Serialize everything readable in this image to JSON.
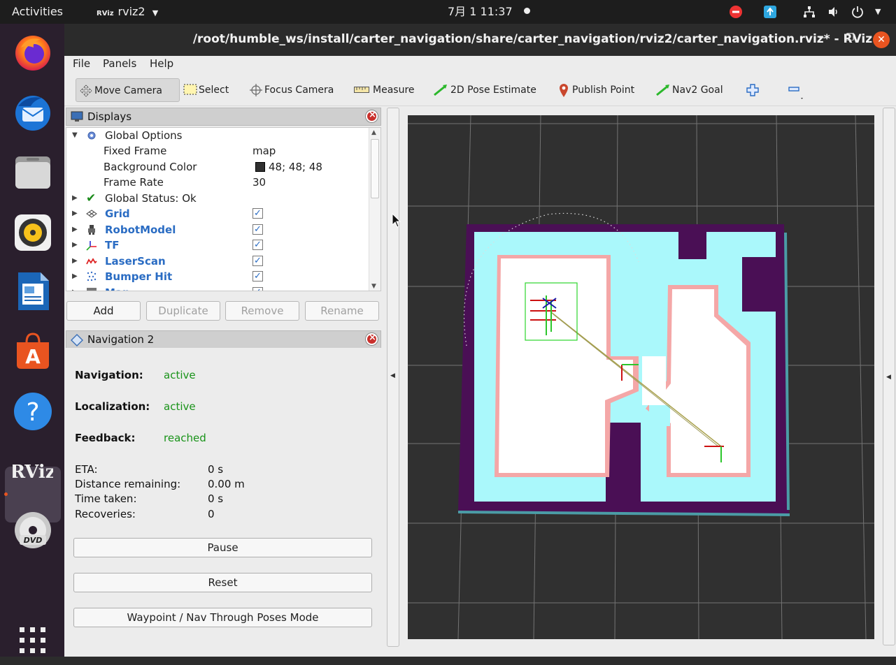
{
  "topbar": {
    "activities": "Activities",
    "app_menu": "rviz2",
    "app_badge": "RViz",
    "clock": "7月 1  11:37"
  },
  "window": {
    "title": "/root/humble_ws/install/carter_navigation/share/carter_navigation/rviz2/carter_navigation.rviz* - RViz"
  },
  "menu": {
    "file": "File",
    "panels": "Panels",
    "help": "Help"
  },
  "toolbar": {
    "move_camera": "Move Camera",
    "select": "Select",
    "focus_camera": "Focus Camera",
    "measure": "Measure",
    "pose_estimate": "2D Pose Estimate",
    "publish_point": "Publish Point",
    "nav2_goal": "Nav2 Goal"
  },
  "displays": {
    "title": "Displays",
    "global_options": "Global Options",
    "fixed_frame_label": "Fixed Frame",
    "fixed_frame_value": "map",
    "bg_color_label": "Background Color",
    "bg_color_value": "48; 48; 48",
    "frame_rate_label": "Frame Rate",
    "frame_rate_value": "30",
    "global_status": "Global Status: Ok",
    "items": [
      {
        "name": "Grid",
        "checked": true
      },
      {
        "name": "RobotModel",
        "checked": true
      },
      {
        "name": "TF",
        "checked": true
      },
      {
        "name": "LaserScan",
        "checked": true
      },
      {
        "name": "Bumper Hit",
        "checked": true
      },
      {
        "name": "Map",
        "checked": true
      }
    ],
    "buttons": {
      "add": "Add",
      "duplicate": "Duplicate",
      "remove": "Remove",
      "rename": "Rename"
    }
  },
  "navigation": {
    "title": "Navigation 2",
    "navigation_label": "Navigation:",
    "navigation_value": "active",
    "localization_label": "Localization:",
    "localization_value": "active",
    "feedback_label": "Feedback:",
    "feedback_value": "reached",
    "eta_label": "ETA:",
    "eta_value": "0 s",
    "distance_label": "Distance remaining:",
    "distance_value": "0.00 m",
    "time_label": "Time taken:",
    "time_value": "0 s",
    "recoveries_label": "Recoveries:",
    "recoveries_value": "0",
    "pause": "Pause",
    "reset": "Reset",
    "mode": "Waypoint / Nav Through Poses Mode"
  },
  "colors": {
    "background": "#303030",
    "map_unknown": "#4a0f55",
    "map_inflation": "#aaf8fb",
    "map_free": "#ffffff",
    "map_obstacle": "#f4a7a7",
    "status_ok": "#199319"
  }
}
